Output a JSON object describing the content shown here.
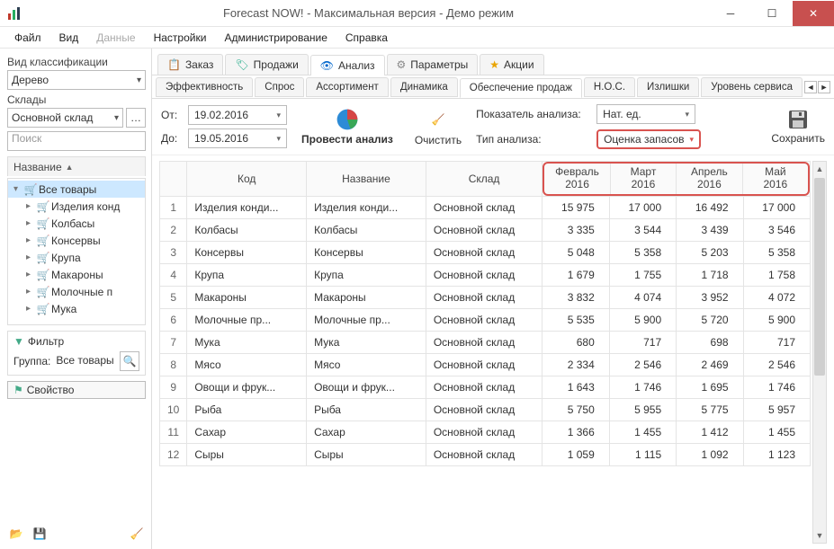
{
  "window": {
    "title": "Forecast NOW! - Максимальная версия - Демо режим"
  },
  "menu": {
    "items": [
      "Файл",
      "Вид",
      "Данные",
      "Настройки",
      "Администрирование",
      "Справка"
    ],
    "inactive_index": 2
  },
  "left": {
    "classification_label": "Вид классификации",
    "classification_value": "Дерево",
    "warehouses_label": "Склады",
    "warehouse_value": "Основной склад",
    "search_placeholder": "Поиск",
    "tree_header": "Название",
    "tree_root": "Все товары",
    "tree_items": [
      "Изделия конд",
      "Колбасы",
      "Консервы",
      "Крупа",
      "Макароны",
      "Молочные п",
      "Мука"
    ],
    "filter_label": "Фильтр",
    "group_label": "Группа:",
    "group_value": "Все товары",
    "property_label": "Свойство"
  },
  "tabs": {
    "top": [
      {
        "label": "Заказ",
        "icon": "clipboard"
      },
      {
        "label": "Продажи",
        "icon": "tag"
      },
      {
        "label": "Анализ",
        "icon": "eye",
        "active": true
      },
      {
        "label": "Параметры",
        "icon": "gear"
      },
      {
        "label": "Акции",
        "icon": "star"
      }
    ],
    "sub": [
      "Эффективность",
      "Спрос",
      "Ассортимент",
      "Динамика",
      "Обеспечение продаж",
      "H.O.C.",
      "Излишки",
      "Уровень сервиса"
    ],
    "sub_active": 4
  },
  "toolbar": {
    "from_label": "От:",
    "to_label": "До:",
    "from_value": "19.02.2016",
    "to_value": "19.05.2016",
    "run_label": "Провести анализ",
    "clear_label": "Очистить",
    "indicator_label": "Показатель анализа:",
    "indicator_value": "Нат. ед.",
    "type_label": "Тип анализа:",
    "type_value": "Оценка запасов",
    "save_label": "Сохранить"
  },
  "grid": {
    "columns": [
      "Код",
      "Название",
      "Склад"
    ],
    "month_headers": [
      {
        "m": "Февраль",
        "y": "2016"
      },
      {
        "m": "Март",
        "y": "2016"
      },
      {
        "m": "Апрель",
        "y": "2016"
      },
      {
        "m": "Май",
        "y": "2016"
      }
    ],
    "rows": [
      {
        "n": 1,
        "code": "Изделия конди...",
        "name": "Изделия конди...",
        "wh": "Основной склад",
        "v": [
          "15 975",
          "17 000",
          "16 492",
          "17 000"
        ]
      },
      {
        "n": 2,
        "code": "Колбасы",
        "name": "Колбасы",
        "wh": "Основной склад",
        "v": [
          "3 335",
          "3 544",
          "3 439",
          "3 546"
        ]
      },
      {
        "n": 3,
        "code": "Консервы",
        "name": "Консервы",
        "wh": "Основной склад",
        "v": [
          "5 048",
          "5 358",
          "5 203",
          "5 358"
        ]
      },
      {
        "n": 4,
        "code": "Крупа",
        "name": "Крупа",
        "wh": "Основной склад",
        "v": [
          "1 679",
          "1 755",
          "1 718",
          "1 758"
        ]
      },
      {
        "n": 5,
        "code": "Макароны",
        "name": "Макароны",
        "wh": "Основной склад",
        "v": [
          "3 832",
          "4 074",
          "3 952",
          "4 072"
        ]
      },
      {
        "n": 6,
        "code": "Молочные пр...",
        "name": "Молочные пр...",
        "wh": "Основной склад",
        "v": [
          "5 535",
          "5 900",
          "5 720",
          "5 900"
        ]
      },
      {
        "n": 7,
        "code": "Мука",
        "name": "Мука",
        "wh": "Основной склад",
        "v": [
          "680",
          "717",
          "698",
          "717"
        ]
      },
      {
        "n": 8,
        "code": "Мясо",
        "name": "Мясо",
        "wh": "Основной склад",
        "v": [
          "2 334",
          "2 546",
          "2 469",
          "2 546"
        ]
      },
      {
        "n": 9,
        "code": "Овощи и фрук...",
        "name": "Овощи и фрук...",
        "wh": "Основной склад",
        "v": [
          "1 643",
          "1 746",
          "1 695",
          "1 746"
        ]
      },
      {
        "n": 10,
        "code": "Рыба",
        "name": "Рыба",
        "wh": "Основной склад",
        "v": [
          "5 750",
          "5 955",
          "5 775",
          "5 957"
        ]
      },
      {
        "n": 11,
        "code": "Сахар",
        "name": "Сахар",
        "wh": "Основной склад",
        "v": [
          "1 366",
          "1 455",
          "1 412",
          "1 455"
        ]
      },
      {
        "n": 12,
        "code": "Сыры",
        "name": "Сыры",
        "wh": "Основной склад",
        "v": [
          "1 059",
          "1 115",
          "1 092",
          "1 123"
        ]
      }
    ]
  }
}
